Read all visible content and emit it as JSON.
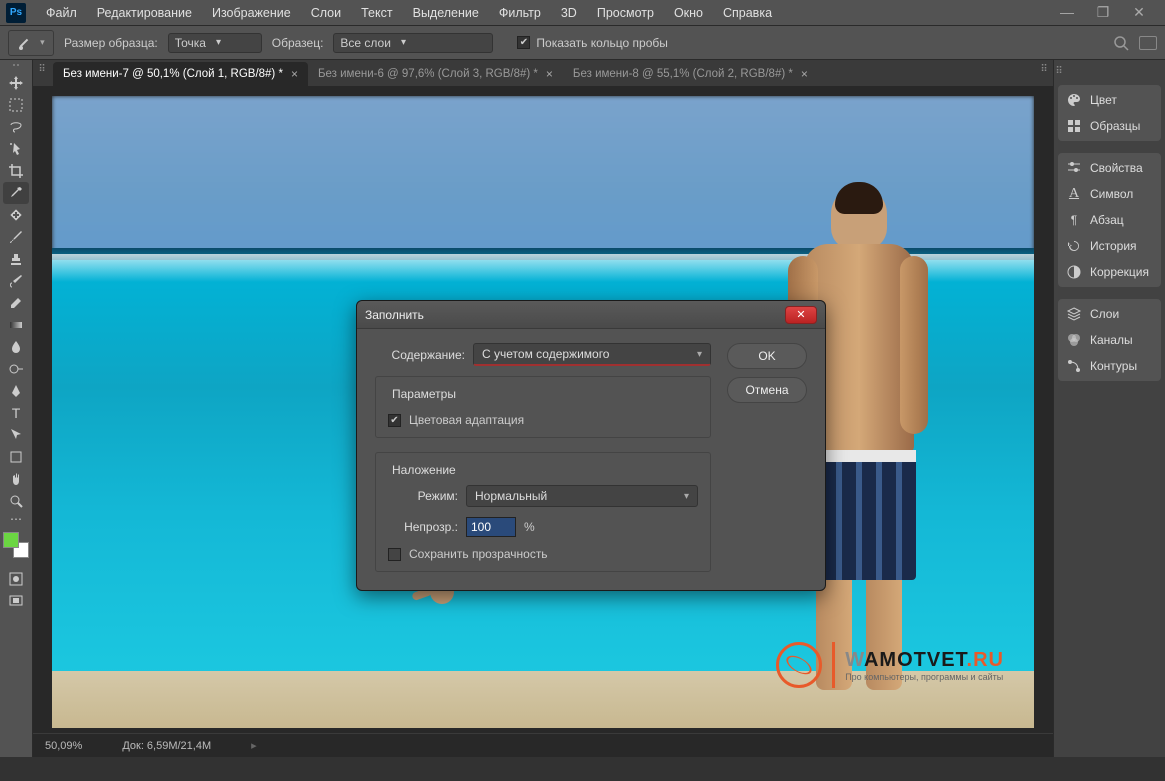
{
  "menu": [
    "Файл",
    "Редактирование",
    "Изображение",
    "Слои",
    "Текст",
    "Выделение",
    "Фильтр",
    "3D",
    "Просмотр",
    "Окно",
    "Справка"
  ],
  "optbar": {
    "sample_size_label": "Размер образца:",
    "sample_size_value": "Точка",
    "sample_label": "Образец:",
    "sample_value": "Все слои",
    "show_ring": "Показать кольцо пробы"
  },
  "tabs": [
    {
      "label": "Без имени-7 @ 50,1% (Слой 1, RGB/8#) *",
      "active": true
    },
    {
      "label": "Без имени-6 @ 97,6% (Слой 3, RGB/8#) *",
      "active": false
    },
    {
      "label": "Без имени-8 @ 55,1% (Слой 2, RGB/8#) *",
      "active": false
    }
  ],
  "panels": {
    "g1": [
      {
        "icon": "palette",
        "label": "Цвет"
      },
      {
        "icon": "grid",
        "label": "Образцы"
      }
    ],
    "g2": [
      {
        "icon": "sliders",
        "label": "Свойства"
      },
      {
        "icon": "type",
        "label": "Символ"
      },
      {
        "icon": "paragraph",
        "label": "Абзац"
      },
      {
        "icon": "history",
        "label": "История"
      },
      {
        "icon": "adjust",
        "label": "Коррекция"
      }
    ],
    "g3": [
      {
        "icon": "layers",
        "label": "Слои"
      },
      {
        "icon": "channels",
        "label": "Каналы"
      },
      {
        "icon": "paths",
        "label": "Контуры"
      }
    ]
  },
  "dialog": {
    "title": "Заполнить",
    "content_label": "Содержание:",
    "content_value": "С учетом содержимого",
    "params": "Параметры",
    "color_adapt": "Цветовая адаптация",
    "blending": "Наложение",
    "mode_label": "Режим:",
    "mode_value": "Нормальный",
    "opacity_label": "Непрозр.:",
    "opacity_value": "100",
    "opacity_unit": "%",
    "preserve": "Сохранить прозрачность",
    "ok": "OK",
    "cancel": "Отмена"
  },
  "status": {
    "zoom": "50,09%",
    "doc": "Док: 6,59M/21,4M"
  },
  "watermark": {
    "title_pre": "W",
    "title_mid": "AMOTVET",
    "title_suf": ".RU",
    "sub": "Про компьютеры, программы и сайты"
  }
}
